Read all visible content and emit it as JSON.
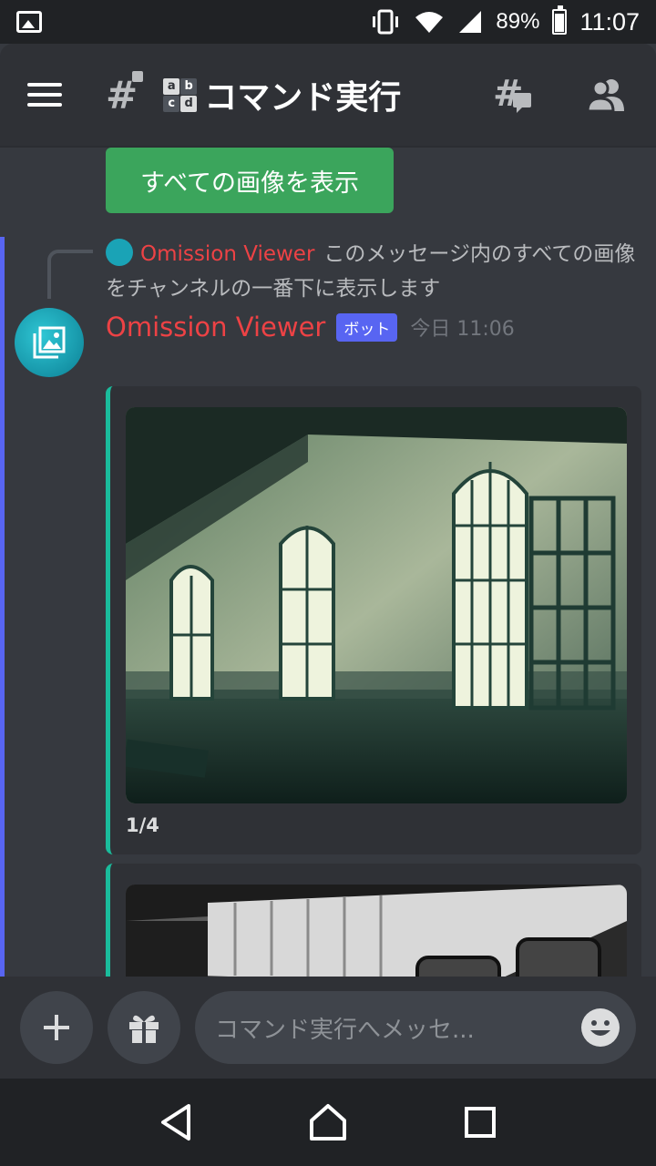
{
  "status_bar": {
    "battery_percent": "89%",
    "time": "11:07"
  },
  "header": {
    "channel_icon_letters": [
      "a",
      "b",
      "c",
      "d"
    ],
    "channel_name": "コマンド実行"
  },
  "messages": {
    "show_all_button": "すべての画像を表示",
    "reply": {
      "author": "Omission Viewer",
      "text": "このメッセージ内のすべての画像をチャンネルの一番下に表示します"
    },
    "message": {
      "author": "Omission Viewer",
      "badge": "ボット",
      "timestamp": "今日 11:06"
    },
    "embeds": [
      {
        "counter": "1/4"
      }
    ]
  },
  "input": {
    "placeholder": "コマンド実行へメッセ..."
  },
  "colors": {
    "accent": "#5865f2",
    "bot_name": "#ed4245",
    "button_green": "#3ba55c",
    "embed_border": "#1abc9c"
  }
}
